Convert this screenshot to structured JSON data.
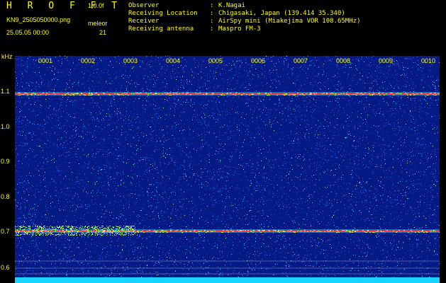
{
  "header": {
    "brand": "H R O F F T",
    "version": "1.0.0f",
    "filename": "KN9_2505050000.png",
    "datetime": "25.05.05 00:00",
    "site_label": "meleor",
    "count": "21"
  },
  "meta": [
    {
      "key": "Observer",
      "value": "K.Nagai"
    },
    {
      "key": "Receiving Location",
      "value": "Chigasaki, Japan (139.414 35.340)"
    },
    {
      "key": "Receiver",
      "value": "AirSpy mini (Miakejima VOR 108.65MHz)"
    },
    {
      "key": "Receiving antenna",
      "value": "Maspro FM-3"
    }
  ],
  "axis": {
    "y_unit": "kHz",
    "y_ticks": [
      "1.1",
      "1.0",
      "0.9",
      "0.8",
      "0.7",
      "0.6"
    ],
    "x_ticks": [
      "0001",
      "0002",
      "0003",
      "0004",
      "0005",
      "0006",
      "0007",
      "0008",
      "0009",
      "0010"
    ]
  },
  "colors": {
    "background": "#061a86",
    "label": "#ffff00",
    "baseline": "#19d3ff"
  }
}
